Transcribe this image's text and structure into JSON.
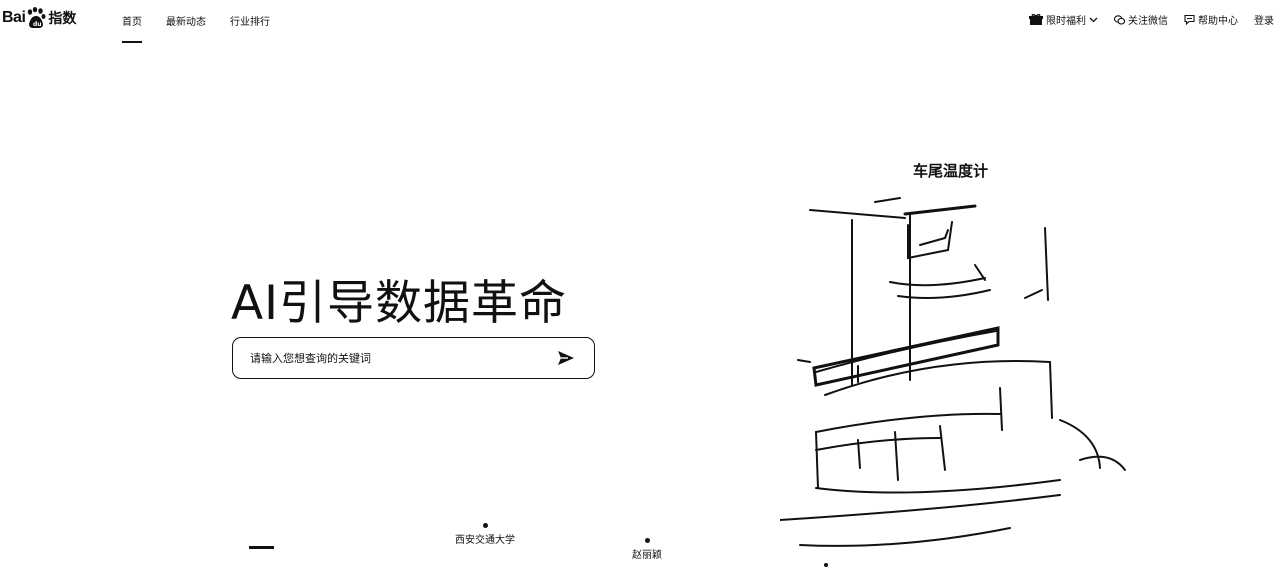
{
  "header": {
    "logo": {
      "bai": "Bai",
      "zh": "指数"
    },
    "nav": [
      {
        "label": "首页",
        "active": true
      },
      {
        "label": "最新动态",
        "active": false
      },
      {
        "label": "行业排行",
        "active": false
      }
    ],
    "right": {
      "promo": "限时福利",
      "wechat": "关注微信",
      "help": "帮助中心",
      "login": "登录"
    }
  },
  "hero": {
    "title": "AI引导数据革命",
    "search_placeholder": "请输入您想查询的关键词"
  },
  "illustration": {
    "label": "车尾温度计"
  },
  "markers": [
    {
      "label": "西安交通大学"
    },
    {
      "label": "赵丽颖"
    }
  ],
  "icons": {
    "promo": "gift-icon",
    "promo_arrow": "chevron-down-icon",
    "wechat": "wechat-icon",
    "help": "chat-bubble-icon",
    "search": "send-arrow-icon",
    "logo": "paw-icon"
  }
}
